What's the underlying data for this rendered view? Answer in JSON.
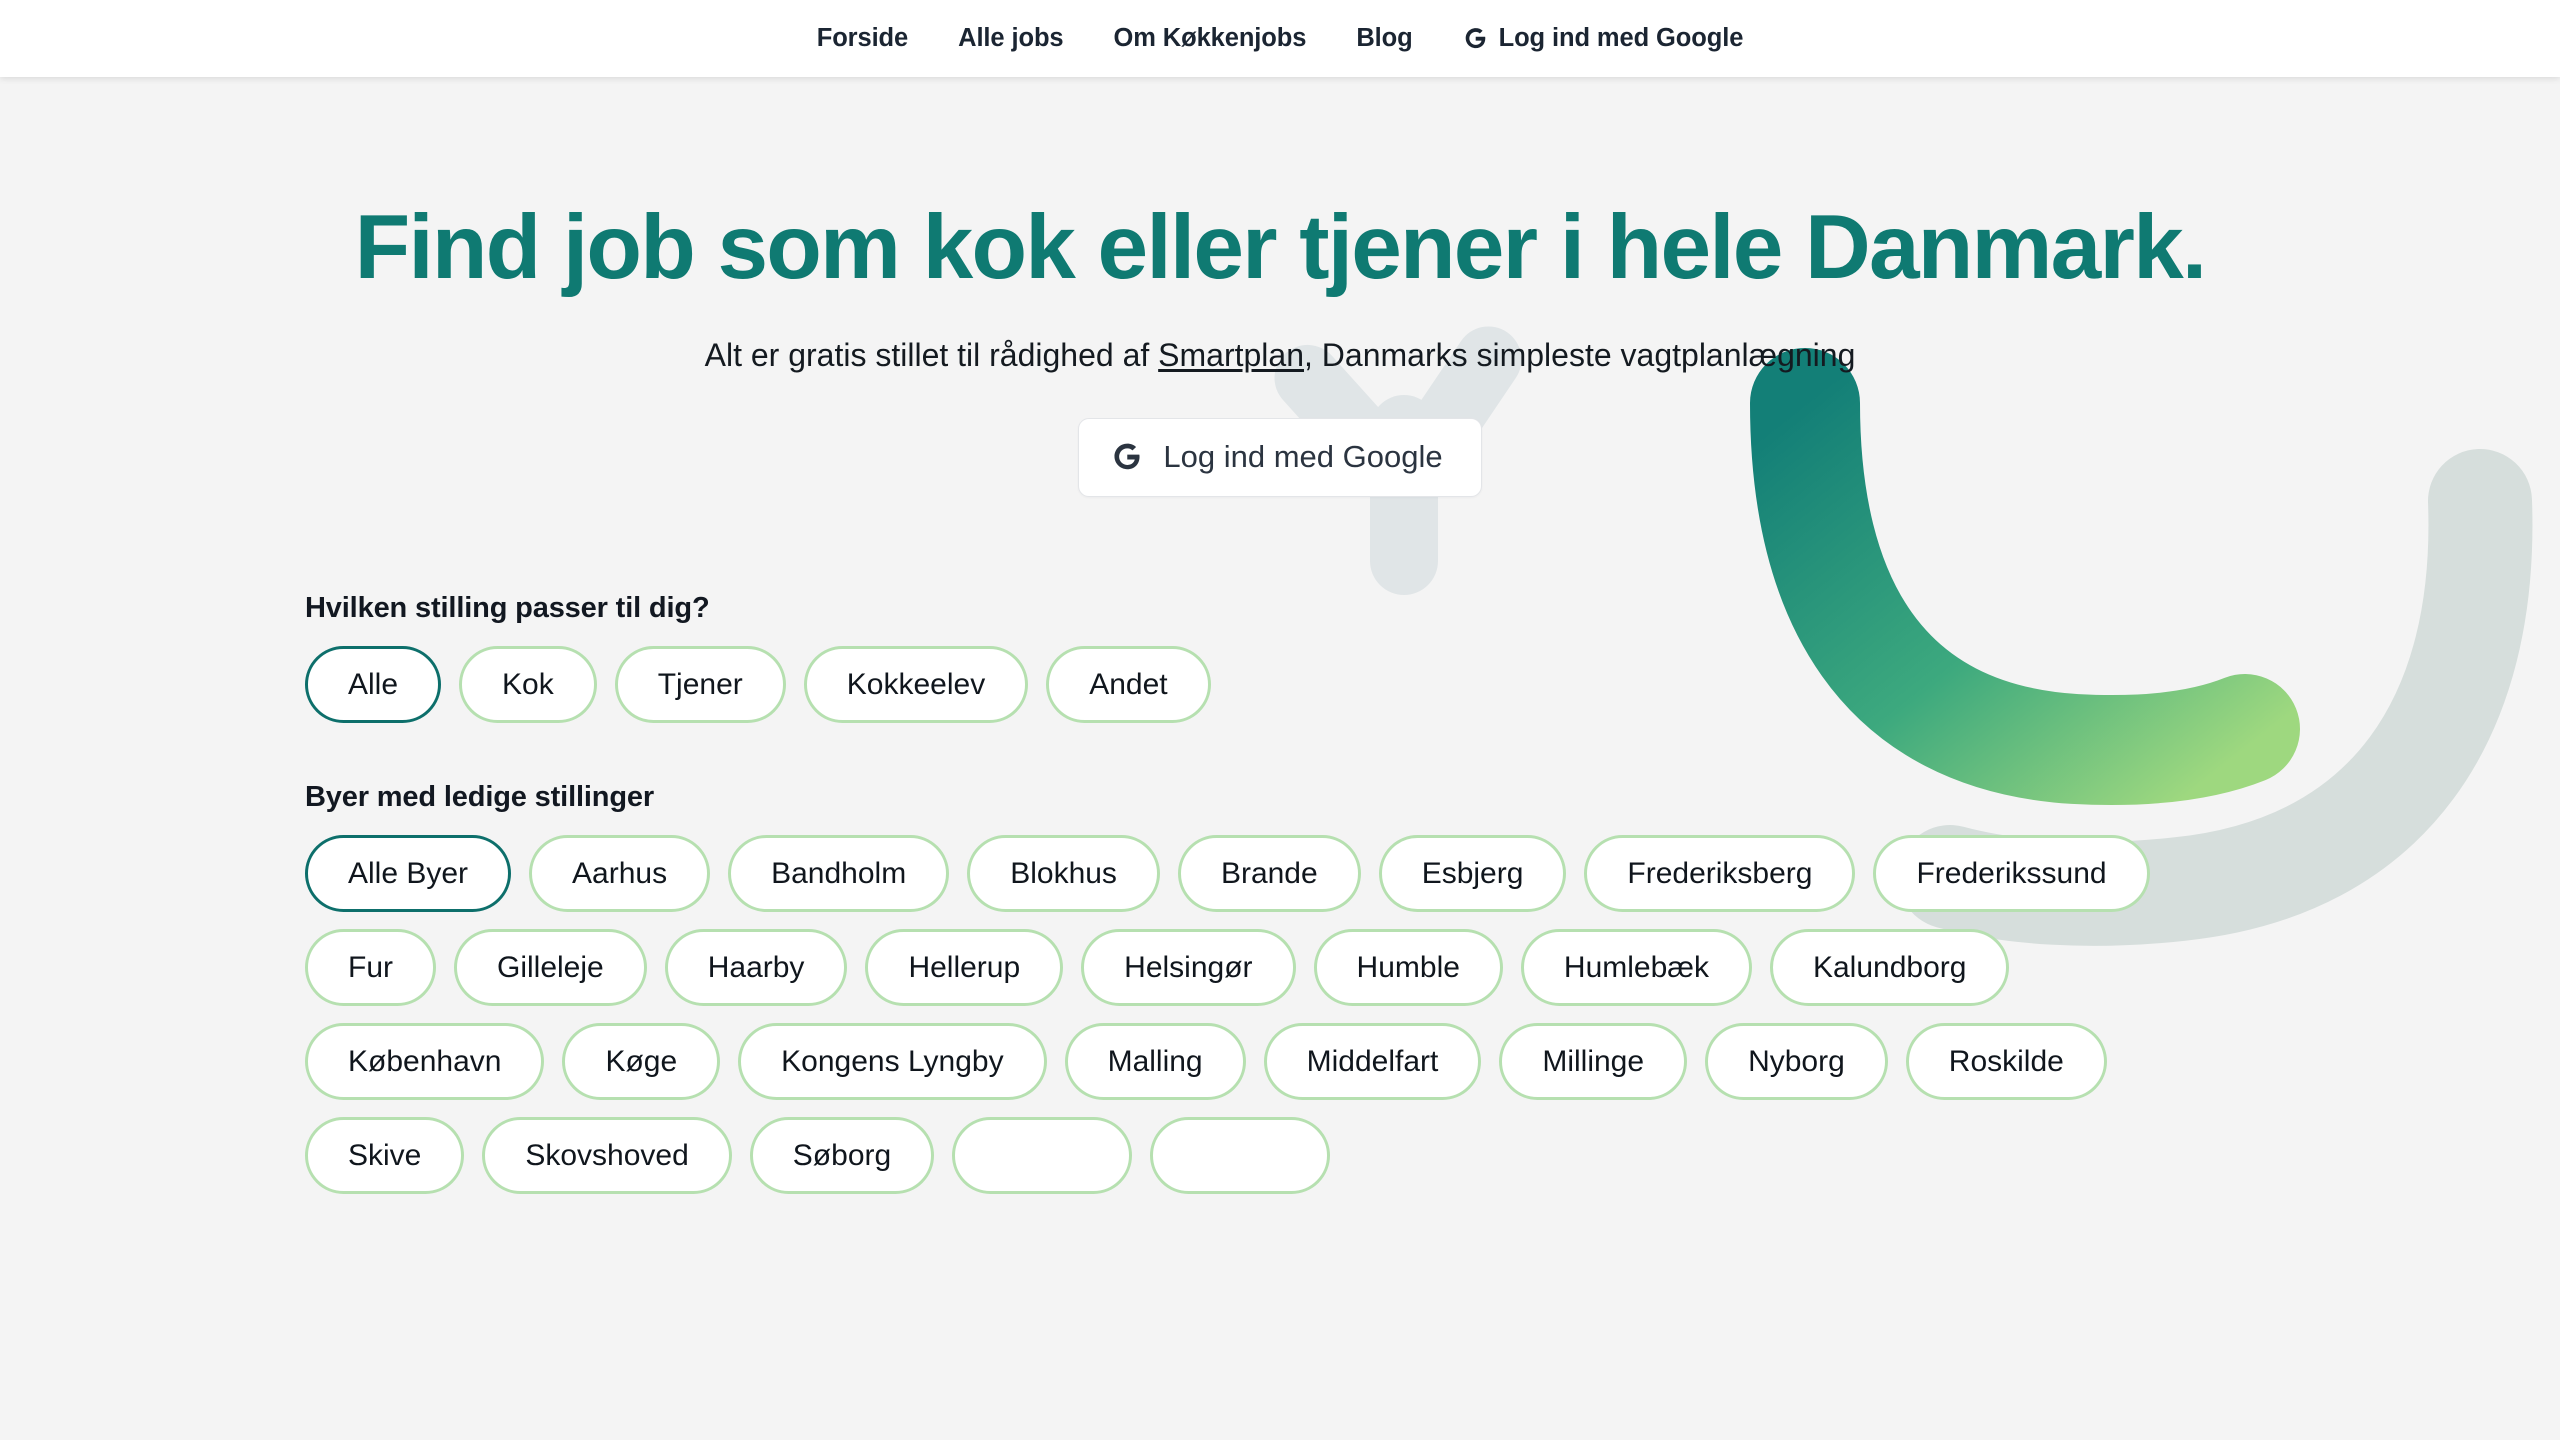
{
  "nav": {
    "items": [
      {
        "label": "Forside",
        "icon": null
      },
      {
        "label": "Alle jobs",
        "icon": null
      },
      {
        "label": "Om Køkkenjobs",
        "icon": null
      },
      {
        "label": "Blog",
        "icon": null
      },
      {
        "label": "Log ind med Google",
        "icon": "google-g-icon"
      }
    ]
  },
  "hero": {
    "title": "Find job som kok eller tjener i hele Danmark.",
    "subtitle_before": "Alt er gratis stillet til rådighed af ",
    "subtitle_link": "Smartplan",
    "subtitle_after": ", Danmarks simpleste vagtplanlægning",
    "login_button": "Log ind med Google",
    "login_icon": "google-g-icon"
  },
  "positions": {
    "title": "Hvilken stilling passer til dig?",
    "chips": [
      {
        "label": "Alle",
        "selected": true
      },
      {
        "label": "Kok",
        "selected": false
      },
      {
        "label": "Tjener",
        "selected": false
      },
      {
        "label": "Kokkeelev",
        "selected": false
      },
      {
        "label": "Andet",
        "selected": false
      }
    ]
  },
  "cities": {
    "title": "Byer med ledige stillinger",
    "chips": [
      {
        "label": "Alle Byer",
        "selected": true
      },
      {
        "label": "Aarhus",
        "selected": false
      },
      {
        "label": "Bandholm",
        "selected": false
      },
      {
        "label": "Blokhus",
        "selected": false
      },
      {
        "label": "Brande",
        "selected": false
      },
      {
        "label": "Esbjerg",
        "selected": false
      },
      {
        "label": "Frederiksberg",
        "selected": false
      },
      {
        "label": "Frederikssund",
        "selected": false
      },
      {
        "label": "Fur",
        "selected": false
      },
      {
        "label": "Gilleleje",
        "selected": false
      },
      {
        "label": "Haarby",
        "selected": false
      },
      {
        "label": "Hellerup",
        "selected": false
      },
      {
        "label": "Helsingør",
        "selected": false
      },
      {
        "label": "Humble",
        "selected": false
      },
      {
        "label": "Humlebæk",
        "selected": false
      },
      {
        "label": "Kalundborg",
        "selected": false
      },
      {
        "label": "København",
        "selected": false
      },
      {
        "label": "Køge",
        "selected": false
      },
      {
        "label": "Kongens Lyngby",
        "selected": false
      },
      {
        "label": "Malling",
        "selected": false
      },
      {
        "label": "Middelfart",
        "selected": false
      },
      {
        "label": "Millinge",
        "selected": false
      },
      {
        "label": "Nyborg",
        "selected": false
      },
      {
        "label": "Roskilde",
        "selected": false
      },
      {
        "label": "Skive",
        "selected": false
      },
      {
        "label": "Skovshoved",
        "selected": false
      },
      {
        "label": "Søborg",
        "selected": false
      },
      {
        "label": "",
        "selected": false
      },
      {
        "label": "",
        "selected": false
      }
    ]
  },
  "colors": {
    "heading_teal": "#0f7a72",
    "chip_border": "#b6e0b0",
    "chip_border_selected": "#0d6f6b",
    "page_background": "#f4f4f4",
    "nav_background": "#ffffff",
    "swoosh_dark": "#15847b",
    "swoosh_light": "#8ed27c",
    "swoosh_gray": "#d6dedc"
  }
}
